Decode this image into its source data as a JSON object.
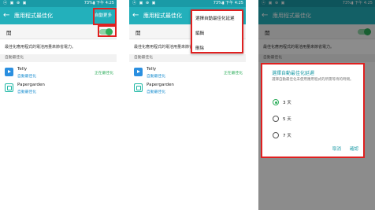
{
  "status": {
    "left": "ⓐ ▣ ⊕ ▣",
    "right": "73%▮ 下午 4:25"
  },
  "appbar": {
    "back": "←",
    "title": "應用程式最佳化",
    "more": "自動更多"
  },
  "toggle_label": "開",
  "description": "最佳化應用程式的電池用量來節省電力。",
  "section_header": "自動最佳化",
  "apps": [
    {
      "name": "Telly",
      "status": "自動最佳化",
      "right": "正在最佳化",
      "icon": "play-icon"
    },
    {
      "name": "Papergarden",
      "status": "自動最佳化",
      "right": "",
      "icon": "app-icon"
    }
  ],
  "menu": {
    "items": [
      "選擇自動最佳化延遲",
      "編輯",
      "刪除"
    ]
  },
  "dialog": {
    "title": "選擇自動最佳化延遲",
    "desc": "選擇自動最佳化未使用應用程式的所需等待的時間。",
    "options": [
      "3 天",
      "5 天",
      "7 天"
    ],
    "cancel": "取消",
    "ok": "確認"
  },
  "colors": {
    "statusbar": "#1a9aa6",
    "appbar": "#23b0bb",
    "highlight": "#e02020",
    "accent_green": "#2fae5c"
  }
}
